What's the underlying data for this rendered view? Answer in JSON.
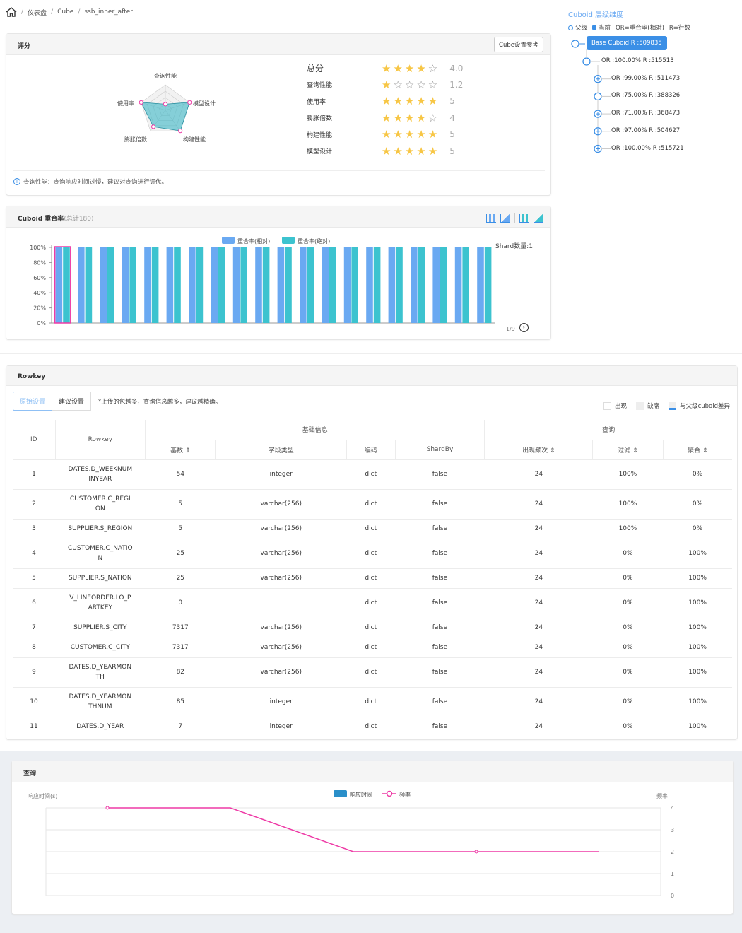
{
  "breadcrumb": {
    "home": "仪表盘",
    "cube": "Cube",
    "name": "ssb_inner_after",
    "sep": "/"
  },
  "score": {
    "title": "评分",
    "ref_button": "Cube设置参考",
    "total_label": "总分",
    "total_value": "4.0",
    "rows": [
      {
        "label": "查询性能",
        "stars": 1.2,
        "value": "1.2"
      },
      {
        "label": "使用率",
        "stars": 5,
        "value": "5"
      },
      {
        "label": "膨胀倍数",
        "stars": 4,
        "value": "4"
      },
      {
        "label": "构建性能",
        "stars": 5,
        "value": "5"
      },
      {
        "label": "模型设计",
        "stars": 5,
        "value": "5"
      }
    ],
    "radar_labels": {
      "top": "查询性能",
      "right": "模型设计",
      "bottom_right": "构建性能",
      "bottom_left": "膨胀倍数",
      "left": "使用率"
    },
    "tip": "查询性能：查询响应时间过慢，建议对查询进行调优。"
  },
  "cuboid": {
    "title": "Cuboid 重合率",
    "subtitle": "(总计180)",
    "pager": "1/9",
    "shard": "Shard数量:1",
    "legend": [
      "重合率(相对)",
      "重合率(绝对)"
    ],
    "colors": {
      "relative": "#6aa9f2",
      "absolute": "#3cc3cf"
    }
  },
  "tree": {
    "title": "Cuboid 层级维度",
    "legend_parent": "父级",
    "legend_current": "当前",
    "legend_or": "OR=重合率(相对)",
    "legend_r": "R=行数",
    "root": "Base Cuboid R :509835",
    "nodes": [
      {
        "text": "OR :100.00%",
        "r": "R :515513"
      },
      {
        "text": "OR :99.00%",
        "r": "R :511473"
      },
      {
        "text": "OR :75.00%",
        "r": "R :388326"
      },
      {
        "text": "OR :71.00%",
        "r": "R :368473"
      },
      {
        "text": "OR :97.00%",
        "r": "R :504627"
      },
      {
        "text": "OR :100.00%",
        "r": "R :515721"
      }
    ]
  },
  "rowkey": {
    "title": "Rowkey",
    "tab_original": "原始设置",
    "tab_suggest": "建议设置",
    "note": "*上传的包越多，查询信息越多，建议越精确。",
    "legend_appear": "出现",
    "legend_missing": "缺席",
    "legend_diff": "与父级cuboid差异",
    "group_basic": "基础信息",
    "group_query": "查询",
    "headers": {
      "id": "ID",
      "rowkey": "Rowkey",
      "cardinality": "基数 ⇕",
      "type": "字段类型",
      "encoding": "编码",
      "shardby": "ShardBy",
      "freq": "出现频次 ⇕",
      "filter": "过滤 ⇕",
      "agg": "聚合 ⇕"
    },
    "rows": [
      [
        "1",
        "DATES.D_WEEKNUM INYEAR",
        "54",
        "integer",
        "dict",
        "false",
        "24",
        "100%",
        "0%"
      ],
      [
        "2",
        "CUSTOMER.C_REGI ON",
        "5",
        "varchar(256)",
        "dict",
        "false",
        "24",
        "100%",
        "0%"
      ],
      [
        "3",
        "SUPPLIER.S_REGION",
        "5",
        "varchar(256)",
        "dict",
        "false",
        "24",
        "100%",
        "0%"
      ],
      [
        "4",
        "CUSTOMER.C_NATIO N",
        "25",
        "varchar(256)",
        "dict",
        "false",
        "24",
        "0%",
        "100%"
      ],
      [
        "5",
        "SUPPLIER.S_NATION",
        "25",
        "varchar(256)",
        "dict",
        "false",
        "24",
        "0%",
        "100%"
      ],
      [
        "6",
        "V_LINEORDER.LO_P ARTKEY",
        "0",
        "",
        "dict",
        "false",
        "24",
        "0%",
        "100%"
      ],
      [
        "7",
        "SUPPLIER.S_CITY",
        "7317",
        "varchar(256)",
        "dict",
        "false",
        "24",
        "0%",
        "100%"
      ],
      [
        "8",
        "CUSTOMER.C_CITY",
        "7317",
        "varchar(256)",
        "dict",
        "false",
        "24",
        "0%",
        "100%"
      ],
      [
        "9",
        "DATES.D_YEARMON TH",
        "82",
        "varchar(256)",
        "dict",
        "false",
        "24",
        "0%",
        "100%"
      ],
      [
        "10",
        "DATES.D_YEARMON THNUM",
        "85",
        "integer",
        "dict",
        "false",
        "24",
        "0%",
        "100%"
      ],
      [
        "11",
        "DATES.D_YEAR",
        "7",
        "integer",
        "dict",
        "false",
        "24",
        "0%",
        "100%"
      ]
    ]
  },
  "query": {
    "title": "查询",
    "legend_time": "响应时间",
    "legend_freq": "频率",
    "left_axis": "响应时间(s)",
    "right_axis": "频率"
  },
  "chart_data": [
    {
      "type": "bar",
      "title": "Cuboid 重合率",
      "subtitle": "(总计180)",
      "ylim": [
        0,
        100
      ],
      "yticks": [
        "0%",
        "20%",
        "40%",
        "60%",
        "80%",
        "100%"
      ],
      "series": [
        {
          "name": "重合率(相对)",
          "values": [
            100,
            100,
            100,
            100,
            100,
            100,
            100,
            100,
            100,
            100,
            100,
            100,
            100,
            100,
            100,
            100,
            100,
            100,
            100,
            100
          ]
        },
        {
          "name": "重合率(绝对)",
          "values": [
            100,
            100,
            100,
            100,
            100,
            100,
            100,
            100,
            100,
            100,
            100,
            100,
            100,
            100,
            100,
            100,
            100,
            100,
            100,
            100
          ]
        }
      ]
    },
    {
      "type": "line",
      "ylabel": "响应时间(s)",
      "y2label": "频率",
      "y2lim": [
        0,
        4
      ],
      "y2ticks": [
        "0",
        "1",
        "2",
        "3",
        "4"
      ],
      "series": [
        {
          "name": "频率",
          "values": [
            4,
            4,
            2,
            2,
            2
          ]
        }
      ]
    }
  ]
}
